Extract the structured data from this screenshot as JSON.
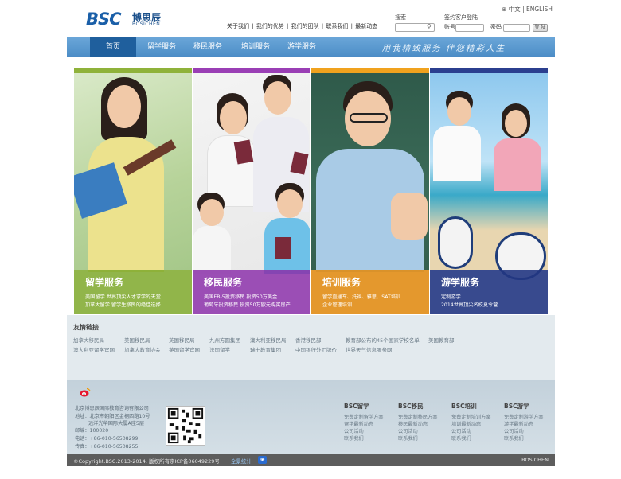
{
  "header": {
    "logo_text": "BSC",
    "logo_cn": "博思辰",
    "logo_en": "BOSICHEN",
    "top_links": [
      "关于我们",
      "我们的优势",
      "我们的团队",
      "联系我们",
      "最新动态"
    ],
    "lang_cn": "中文",
    "lang_en": "ENGLISH",
    "search_label": "搜索",
    "login_title": "签约客户登陆",
    "account_label": "账号",
    "password_label": "密码",
    "login_button": "登 陆"
  },
  "nav": {
    "items": [
      "首页",
      "留学服务",
      "移民服务",
      "培训服务",
      "游学服务"
    ],
    "active": "首页",
    "slogan": "用我精致服务  伴您精彩人生"
  },
  "panels": [
    {
      "title": "留学服务",
      "line1": "美国留学 世界顶尖人才求学的天堂",
      "line2": "加拿大留学 留学生移民的绝佳选择",
      "color": "#8fb23a",
      "cap_color": "#7ea82a"
    },
    {
      "title": "移民服务",
      "line1": "美国EB-5投资移民 投资50万美金",
      "line2": "葡萄牙投资移民 投资50万欧元购买房产",
      "color": "#9a3fb5",
      "cap_color": "#8a2fa8"
    },
    {
      "title": "培训服务",
      "line1": "留学直通车、托福、雅思、SAT培训",
      "line2": "企业管理培训",
      "color": "#f0a21e",
      "cap_color": "#e08a10"
    },
    {
      "title": "游学服务",
      "line1": "定制游学",
      "line2": "2014世界顶尖名校夏令营",
      "color": "#2b3f8f",
      "cap_color": "#223682"
    }
  ],
  "friend_links": {
    "title": "友情链接",
    "row1": [
      "加拿大移民局",
      "美国移民局",
      "英国移民局",
      "九州方圆集团",
      "澳大利亚移民局",
      "香港移民部",
      "教育部公布的45个国家学校名单",
      "美国教育部"
    ],
    "row2": [
      "澳大利亚留学官网",
      "加拿大教育协会",
      "英国留学官网",
      "法国留学",
      "瑞士教育集团",
      "中国银行外汇牌价",
      "世界天气信息服务网"
    ]
  },
  "footer": {
    "company": "北京博思辰国际教育咨询有限公司",
    "address": "地址：北京市朝阳区金桐西路10号",
    "address2": "远洋光华国际大厦A座5层",
    "zip": "邮编：100020",
    "phone": "电话：+86-010-56508299",
    "fax": "传真：+86-010-56508255",
    "columns": [
      {
        "title": "BSC留学",
        "items": [
          "免费定制留学方案",
          "留学最新动态",
          "公司活动",
          "联系我们"
        ]
      },
      {
        "title": "BSC移民",
        "items": [
          "免费定制移民方案",
          "移民最新动态",
          "公司活动",
          "联系我们"
        ]
      },
      {
        "title": "BSC培训",
        "items": [
          "免费定制培训方案",
          "培训最新动态",
          "公司活动",
          "联系我们"
        ]
      },
      {
        "title": "BSC游学",
        "items": [
          "免费定制游学方案",
          "游学最新动态",
          "公司活动",
          "联系我们"
        ]
      }
    ],
    "copyright": "©Copyright.BSC.2013-2014. 版权所有京ICP备06049229号",
    "stats": "全景统计",
    "brand": "BOSICHEN"
  }
}
